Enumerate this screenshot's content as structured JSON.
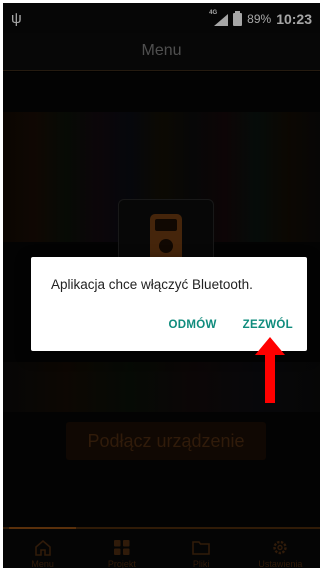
{
  "status_bar": {
    "usb_icon": "usb-icon",
    "network_badge": "4G",
    "battery_percent": "89%",
    "time": "10:23"
  },
  "app_bar": {
    "title": "Menu"
  },
  "content": {
    "device_icon": "multimeter-icon",
    "connect_label": "Podłącz urządzenie"
  },
  "dialog": {
    "message": "Aplikacja chce włączyć Bluetooth.",
    "deny_label": "ODMÓW",
    "allow_label": "ZEZWÓL"
  },
  "bottom_nav": {
    "items": [
      {
        "label": "Menu",
        "icon": "home-icon",
        "active": true
      },
      {
        "label": "Projekt",
        "icon": "grid-icon",
        "active": false
      },
      {
        "label": "Pliki",
        "icon": "folder-icon",
        "active": false
      },
      {
        "label": "Ustawienia",
        "icon": "gear-icon",
        "active": false
      }
    ]
  },
  "annotation": {
    "arrow_color": "#ff0000",
    "points_to": "ZEZWÓL"
  },
  "colors": {
    "accent": "#8a4a12",
    "dialog_button": "#0f8c7d"
  }
}
